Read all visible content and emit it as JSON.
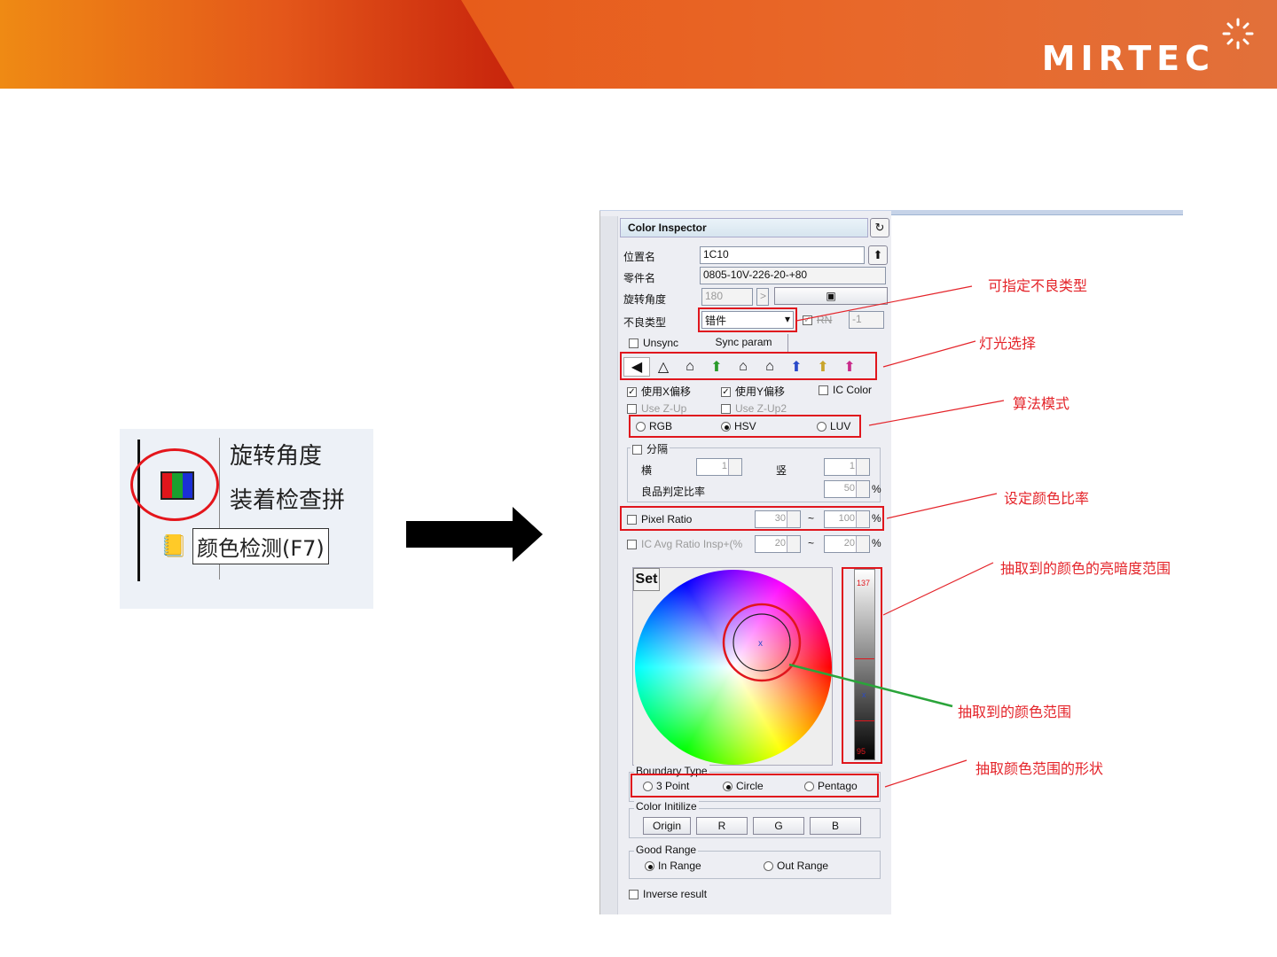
{
  "brand": {
    "logo_text": "MIRTEC"
  },
  "thumbnail": {
    "text_row1": "旋转角度",
    "text_row2": "装着检查拼",
    "tooltip": "颜色检测(F7)"
  },
  "panel": {
    "title": "Color Inspector",
    "fields": {
      "location_label": "位置名",
      "location_value": "1C10",
      "part_label": "零件名",
      "part_value": "0805-10V-226-20-+80",
      "angle_label": "旋转角度",
      "angle_value": "180",
      "defect_label": "不良类型",
      "defect_value": "错件",
      "rn_label": "RN",
      "rn_value": "-1"
    },
    "unsync_label": "Unsync",
    "sync_param_label": "Sync param",
    "lamp_icons": [
      "left-lamp-icon",
      "top-lamp-icon",
      "h-lamp-icon",
      "green-lamp-icon",
      "v-lamp-icon",
      "c-lamp-icon",
      "blue-lamp-icon",
      "yellow-lamp-icon",
      "rgb-lamp-icon"
    ],
    "use_x_label": "使用X偏移",
    "use_y_label": "使用Y偏移",
    "ic_color_label": "IC Color",
    "use_zup_label": "Use Z-Up",
    "use_zup2_label": "Use Z-Up2",
    "algo": {
      "rgb": "RGB",
      "hsv": "HSV",
      "luv": "LUV"
    },
    "split_label": "分隔",
    "horiz_label": "横",
    "horiz_value": "1",
    "vert_label": "竖",
    "vert_value": "1",
    "good_ratio_label": "良品判定比率",
    "good_ratio_value": "50",
    "percent": "%",
    "pixel_ratio_label": "Pixel Ratio",
    "pixel_min": "30",
    "pixel_max": "100",
    "tilde": "~",
    "ic_avg_label": "IC Avg Ratio Insp+(%",
    "ic_avg_min": "20",
    "ic_avg_max": "20",
    "set_label": "Set",
    "bright_top": "137",
    "bright_bottom": "95",
    "boundary": {
      "title": "Boundary Type",
      "p3": "3 Point",
      "circle": "Circle",
      "pentagon": "Pentago"
    },
    "color_init": {
      "title": "Color Initilize",
      "origin": "Origin",
      "r": "R",
      "g": "G",
      "b": "B"
    },
    "good_range": {
      "title": "Good Range",
      "in": "In Range",
      "out": "Out Range"
    },
    "inverse_label": "Inverse result"
  },
  "annotations": {
    "defect_type": "可指定不良类型",
    "light": "灯光选择",
    "algo": "算法模式",
    "ratio": "设定颜色比率",
    "brightness": "抽取到的颜色的亮暗度范围",
    "color_range": "抽取到的颜色范围",
    "shape": "抽取颜色范围的形状"
  },
  "colors": {
    "annotation_red": "#e4242a",
    "highlight_red": "#e0161d",
    "green_line": "#2aa43a"
  }
}
